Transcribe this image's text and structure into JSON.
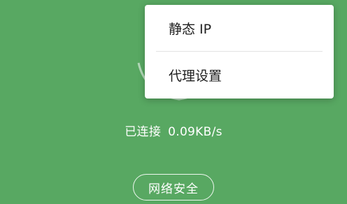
{
  "status": {
    "state": "已连接",
    "speed": "0.09KB/s"
  },
  "security_button": {
    "label": "网络安全"
  },
  "popup_menu": {
    "items": [
      {
        "label": "静态 IP"
      },
      {
        "label": "代理设置"
      }
    ]
  },
  "colors": {
    "background": "#58a862",
    "menu_background": "#ffffff",
    "menu_text": "#202020",
    "status_text": "#ffffff"
  },
  "icons": {
    "background_graphic": "wifi-signal-icon"
  }
}
